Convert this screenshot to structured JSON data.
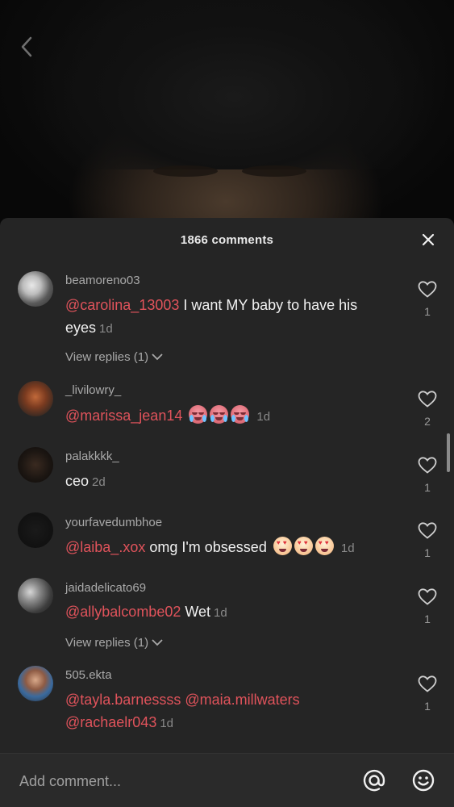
{
  "header": {
    "title": "1866 comments"
  },
  "comments": [
    {
      "username": "beamoreno03",
      "mention": "@carolina_13003",
      "text": " I want MY baby to have his eyes",
      "time": "1d",
      "likes": "1",
      "replies": "View replies (1)"
    },
    {
      "username": "_livilowry_",
      "mention": "@marissa_jean14",
      "text": "",
      "time": "1d",
      "likes": "2"
    },
    {
      "username": "palakkkk_",
      "mention": "",
      "text": "ceo",
      "time": "2d",
      "likes": "1"
    },
    {
      "username": "yourfavedumbhoe",
      "mention": "@laiba_.xox",
      "text": " omg I'm obsessed",
      "time": "1d",
      "likes": "1"
    },
    {
      "username": "jaidadelicato69",
      "mention": "@allybalcombe02",
      "text": " Wet",
      "time": "1d",
      "likes": "1",
      "replies": "View replies (1)"
    },
    {
      "username": "505.ekta",
      "mention": "@tayla.barnessss @maia.millwaters",
      "mention2": "@rachaelr043",
      "time": "1d",
      "likes": "1"
    }
  ],
  "footer": {
    "placeholder": "Add comment..."
  },
  "icons": {
    "back": "chevron-left-icon",
    "close": "close-icon",
    "heart": "heart-outline-icon",
    "mention": "at-sign-icon",
    "emoji": "smiley-icon"
  },
  "colors": {
    "mention": "#e0535b",
    "sheet": "#252525",
    "footer": "#2a2a2a"
  }
}
